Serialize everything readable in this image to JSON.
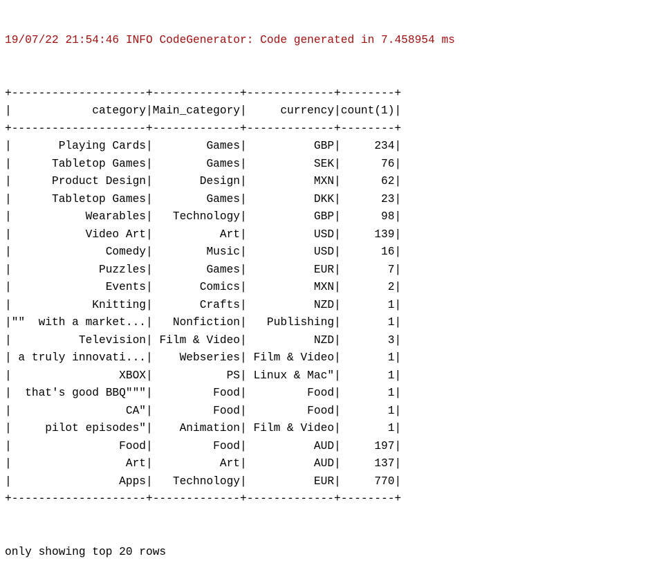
{
  "log": {
    "date": "19/07/22",
    "time": "21:54:46",
    "level": "INFO",
    "source": "CodeGenerator:",
    "message": "Code generated in 7.458954 ms",
    "color": "#a01010"
  },
  "table": {
    "columns": [
      "category",
      "Main_category",
      "currency",
      "count(1)"
    ],
    "widths": [
      20,
      13,
      13,
      8
    ],
    "rows": [
      [
        "Playing Cards",
        "Games",
        "GBP",
        "234"
      ],
      [
        "Tabletop Games",
        "Games",
        "SEK",
        "76"
      ],
      [
        "Product Design",
        "Design",
        "MXN",
        "62"
      ],
      [
        "Tabletop Games",
        "Games",
        "DKK",
        "23"
      ],
      [
        "Wearables",
        "Technology",
        "GBP",
        "98"
      ],
      [
        "Video Art",
        "Art",
        "USD",
        "139"
      ],
      [
        "Comedy",
        "Music",
        "USD",
        "16"
      ],
      [
        "Puzzles",
        "Games",
        "EUR",
        "7"
      ],
      [
        "Events",
        "Comics",
        "MXN",
        "2"
      ],
      [
        "Knitting",
        "Crafts",
        "NZD",
        "1"
      ],
      [
        "\"\"  with a market...",
        "Nonfiction",
        "Publishing",
        "1"
      ],
      [
        "Television",
        "Film & Video",
        "NZD",
        "3"
      ],
      [
        " a truly innovati...",
        "Webseries",
        "Film & Video",
        "1"
      ],
      [
        "XBOX",
        "PS",
        "Linux & Mac\"",
        "1"
      ],
      [
        " that's good BBQ\"\"\"",
        "Food",
        "Food",
        "1"
      ],
      [
        "CA\"",
        "Food",
        "Food",
        "1"
      ],
      [
        "pilot episodes\"",
        "Animation",
        "Film & Video",
        "1"
      ],
      [
        "Food",
        "Food",
        "AUD",
        "197"
      ],
      [
        "Art",
        "Art",
        "AUD",
        "137"
      ],
      [
        "Apps",
        "Technology",
        "EUR",
        "770"
      ]
    ]
  },
  "footer": {
    "text": "only showing top 20 rows"
  }
}
